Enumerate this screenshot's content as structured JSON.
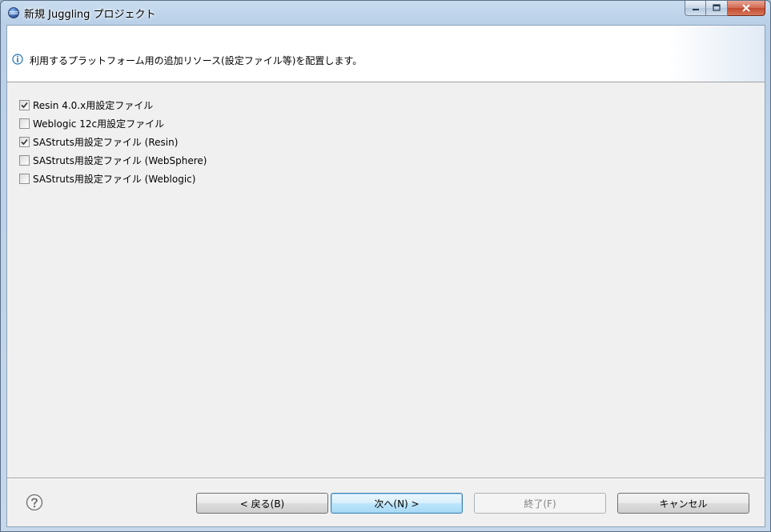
{
  "window": {
    "title": "新規 Juggling プロジェクト",
    "title_icon": "eclipse-globe-icon"
  },
  "window_controls": {
    "minimize_icon": "minimize-icon",
    "maximize_icon": "maximize-icon",
    "close_icon": "close-icon"
  },
  "banner": {
    "icon": "info-icon",
    "message": "利用するプラットフォーム用の追加リソース(設定ファイル等)を配置します。"
  },
  "resources": [
    {
      "label": "Resin 4.0.x用設定ファイル",
      "checked": true
    },
    {
      "label": "Weblogic 12c用設定ファイル",
      "checked": false
    },
    {
      "label": "SAStruts用設定ファイル (Resin)",
      "checked": true
    },
    {
      "label": "SAStruts用設定ファイル (WebSphere)",
      "checked": false
    },
    {
      "label": "SAStruts用設定ファイル (Weblogic)",
      "checked": false
    }
  ],
  "buttons": {
    "help_icon": "help-icon",
    "back": "< 戻る(B)",
    "next": "次へ(N) >",
    "finish": "終了(F)",
    "cancel": "キャンセル"
  },
  "colors": {
    "accent_info": "#1f6fb5",
    "default_button_border": "#3c7fb1"
  }
}
